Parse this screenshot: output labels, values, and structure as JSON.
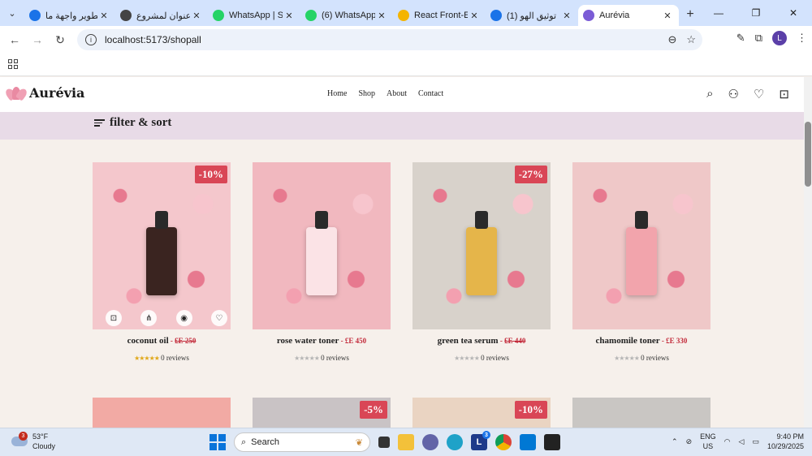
{
  "browser": {
    "tabs": [
      {
        "title": "تطوير واجهة ما",
        "fav_color": "#1a73e8",
        "active": false
      },
      {
        "title": "عنوان لمشروع",
        "fav_color": "#444444",
        "active": false
      },
      {
        "title": "WhatsApp | Se",
        "fav_color": "#25d366",
        "active": false
      },
      {
        "title": "(6) WhatsApp",
        "fav_color": "#25d366",
        "active": false
      },
      {
        "title": "React Front-En",
        "fav_color": "#f4b400",
        "active": false
      },
      {
        "title": "(1) توثيق الهو",
        "fav_color": "#1a73e8",
        "active": false
      },
      {
        "title": "Aurévia",
        "fav_color": "#7b5cd6",
        "active": true
      }
    ],
    "url": "localhost:5173/shopall",
    "profile_initial": "L"
  },
  "site": {
    "brand": "Aurévia",
    "nav": [
      "Home",
      "Shop",
      "About",
      "Contact"
    ],
    "filter_label": "filter & sort"
  },
  "products": [
    {
      "name": "coconut oil",
      "sep": " - ",
      "price": "£E 250",
      "strike": true,
      "badge": "-10%",
      "stars_filled": 5,
      "reviews": "0 reviews",
      "bg": "#f4c7cc",
      "item": "#3a2420",
      "show_actions": true
    },
    {
      "name": "rose water toner",
      "sep": " - ",
      "price": "£E 450",
      "strike": false,
      "badge": "",
      "stars_filled": 0,
      "reviews": "0 reviews",
      "bg": "#f1b8bf",
      "item": "#fbe3e6",
      "show_actions": false
    },
    {
      "name": "green tea serum",
      "sep": " - ",
      "price": "£E 440",
      "strike": true,
      "badge": "-27%",
      "stars_filled": 0,
      "reviews": "0 reviews",
      "bg": "#d8d2cb",
      "item": "#e5b54a",
      "show_actions": false
    },
    {
      "name": "chamomile toner",
      "sep": " - ",
      "price": "£E 330",
      "strike": false,
      "badge": "",
      "stars_filled": 0,
      "reviews": "0 reviews",
      "bg": "#efc8c8",
      "item": "#f2a4ac",
      "show_actions": false
    }
  ],
  "products_row2": [
    {
      "badge": "",
      "bg": "#f2aaa4"
    },
    {
      "badge": "-5%",
      "bg": "#c9c3c5"
    },
    {
      "badge": "-10%",
      "bg": "#ead4c2"
    },
    {
      "badge": "",
      "bg": "#c9c6c3"
    }
  ],
  "taskbar": {
    "temp": "53°F",
    "condition": "Cloudy",
    "weather_badge": "3",
    "search_placeholder": "Search",
    "lang_top": "ENG",
    "lang_bottom": "US",
    "time": "9:40 PM",
    "date": "10/29/2025",
    "app_badge": "3"
  }
}
